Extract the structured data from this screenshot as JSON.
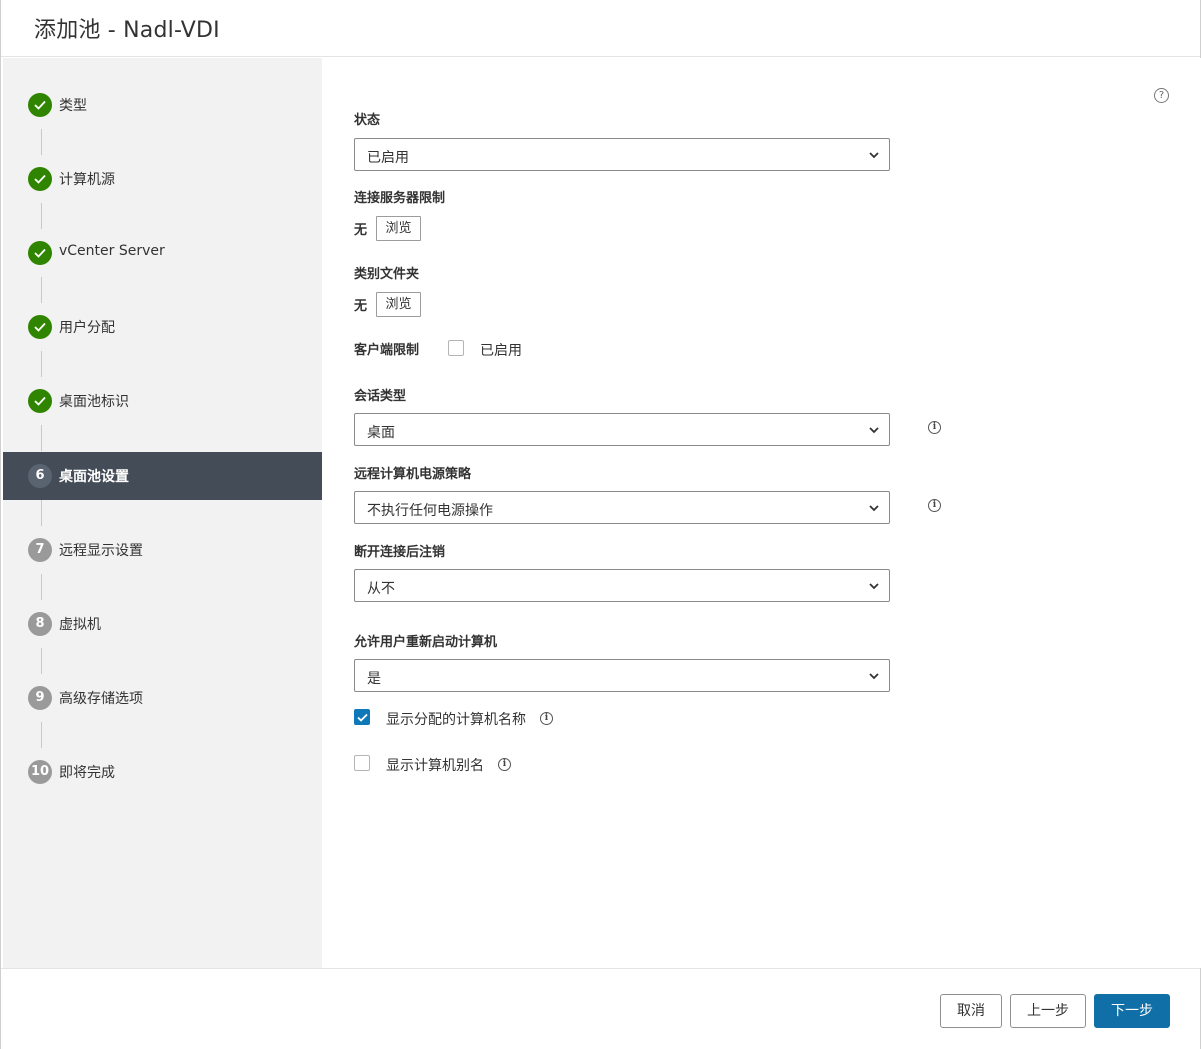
{
  "dialog": {
    "title": "添加池 - Nadl-VDI"
  },
  "steps": [
    {
      "num": "1",
      "label": "类型",
      "state": "done"
    },
    {
      "num": "2",
      "label": "计算机源",
      "state": "done"
    },
    {
      "num": "3",
      "label": "vCenter Server",
      "state": "done"
    },
    {
      "num": "4",
      "label": "用户分配",
      "state": "done"
    },
    {
      "num": "5",
      "label": "桌面池标识",
      "state": "done"
    },
    {
      "num": "6",
      "label": "桌面池设置",
      "state": "current"
    },
    {
      "num": "7",
      "label": "远程显示设置",
      "state": "todo"
    },
    {
      "num": "8",
      "label": "虚拟机",
      "state": "todo"
    },
    {
      "num": "9",
      "label": "高级存储选项",
      "state": "todo"
    },
    {
      "num": "10",
      "label": "即将完成",
      "state": "todo"
    }
  ],
  "form": {
    "help_icon": "?",
    "state": {
      "label": "状态",
      "value": "已启用"
    },
    "conn_server_restriction": {
      "label": "连接服务器限制",
      "value": "无",
      "browse": "浏览"
    },
    "category_folder": {
      "label": "类别文件夹",
      "value": "无",
      "browse": "浏览"
    },
    "client_restriction": {
      "label": "客户端限制",
      "checkbox_label": "已启用",
      "checked": false
    },
    "session_type": {
      "label": "会话类型",
      "value": "桌面"
    },
    "power_policy": {
      "label": "远程计算机电源策略",
      "value": "不执行任何电源操作"
    },
    "logoff_after_disconnect": {
      "label": "断开连接后注销",
      "value": "从不"
    },
    "allow_restart": {
      "label": "允许用户重新启动计算机",
      "value": "是"
    },
    "show_assigned_name": {
      "label": "显示分配的计算机名称",
      "checked": true
    },
    "show_alias": {
      "label": "显示计算机别名",
      "checked": false
    },
    "info_glyph": "i"
  },
  "footer": {
    "cancel": "取消",
    "back": "上一步",
    "next": "下一步"
  },
  "colors": {
    "done": "#2f8400",
    "active_bg": "#434c57",
    "primary": "#0f6fa6",
    "checkbox": "#0f78b8"
  }
}
